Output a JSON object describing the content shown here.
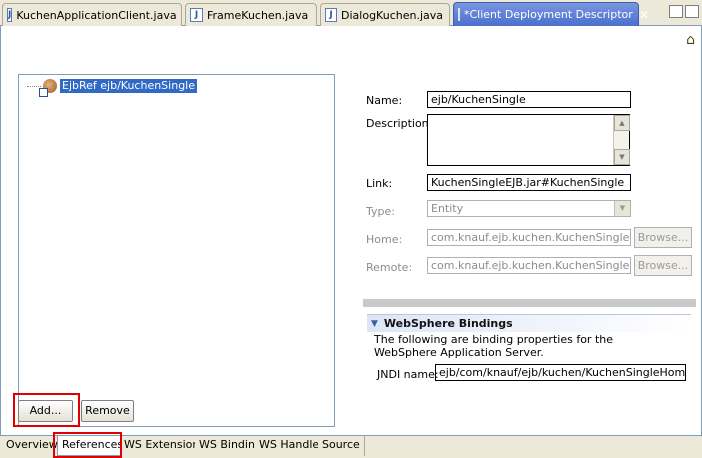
{
  "tabs": [
    {
      "label": "KuchenApplicationClient.java",
      "icon": "java-file-icon"
    },
    {
      "label": "FrameKuchen.java",
      "icon": "java-file-icon"
    },
    {
      "label": "DialogKuchen.java",
      "icon": "java-file-icon"
    },
    {
      "label": "*Client Deployment Descriptor",
      "icon": "deployment-descriptor-icon",
      "active": true
    }
  ],
  "tree": {
    "items": [
      {
        "label": "EjbRef ejb/KuchenSingle",
        "icon": "ejb-reference-icon",
        "selected": true
      }
    ]
  },
  "buttons": {
    "add": "Add...",
    "remove": "Remove",
    "browse": "Browse..."
  },
  "details": {
    "name_label": "Name:",
    "name_value": "ejb/KuchenSingle",
    "description_label": "Description:",
    "description_value": "",
    "link_label": "Link:",
    "link_value": "KuchenSingleEJB.jar#KuchenSingle",
    "type_label": "Type:",
    "type_value": "Entity",
    "home_label": "Home:",
    "home_value": "com.knauf.ejb.kuchen.KuchenSingleHome",
    "remote_label": "Remote:",
    "remote_value": "com.knauf.ejb.kuchen.KuchenSingle"
  },
  "websphere": {
    "title": "WebSphere Bindings",
    "description": "The following are binding properties for the WebSphere Application Server.",
    "jndi_label": "JNDI name:",
    "jndi_value": "ejb/com/knauf/ejb/kuchen/KuchenSingleHome"
  },
  "page_tabs": [
    {
      "label": "Overview"
    },
    {
      "label": "References",
      "active": true
    },
    {
      "label": "WS Extension"
    },
    {
      "label": "WS Binding"
    },
    {
      "label": "WS Handler"
    },
    {
      "label": "Source"
    }
  ],
  "colors": {
    "highlight_box": "#e00000",
    "selection": "#316ac5",
    "active_tab": "#4b6fcf"
  }
}
